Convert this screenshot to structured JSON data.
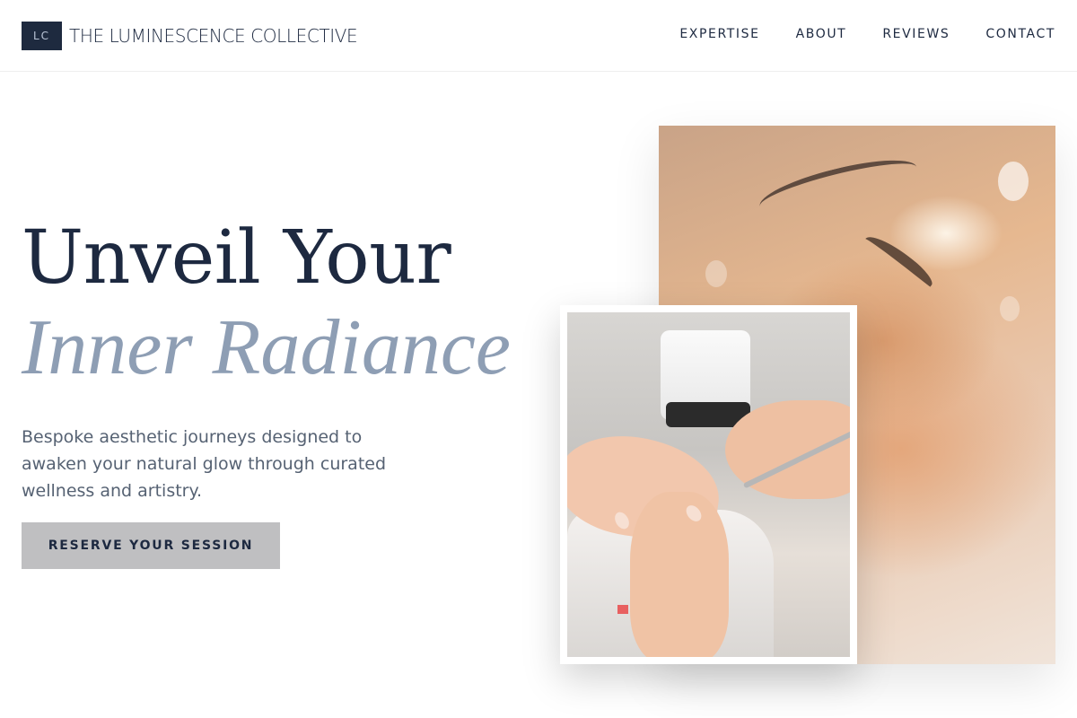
{
  "header": {
    "logo_initials": "LC",
    "brand_name": "THE LUMINESCENCE COLLECTIVE",
    "nav": [
      {
        "label": "EXPERTISE"
      },
      {
        "label": "ABOUT"
      },
      {
        "label": "REVIEWS"
      },
      {
        "label": "CONTACT"
      }
    ]
  },
  "hero": {
    "title_line1": "Unveil Your",
    "title_line2": "Inner Radiance",
    "subtitle": "Bespoke aesthetic journeys designed to awaken your natural glow through curated wellness and artistry.",
    "cta_label": "RESERVE YOUR SESSION"
  },
  "colors": {
    "navy": "#1e2a3f",
    "muted_blue": "#8e9eb4",
    "button_gray": "#bfbfc1"
  },
  "images": {
    "large": "eyebrow-treatment-photo",
    "small": "manicure-photo"
  }
}
